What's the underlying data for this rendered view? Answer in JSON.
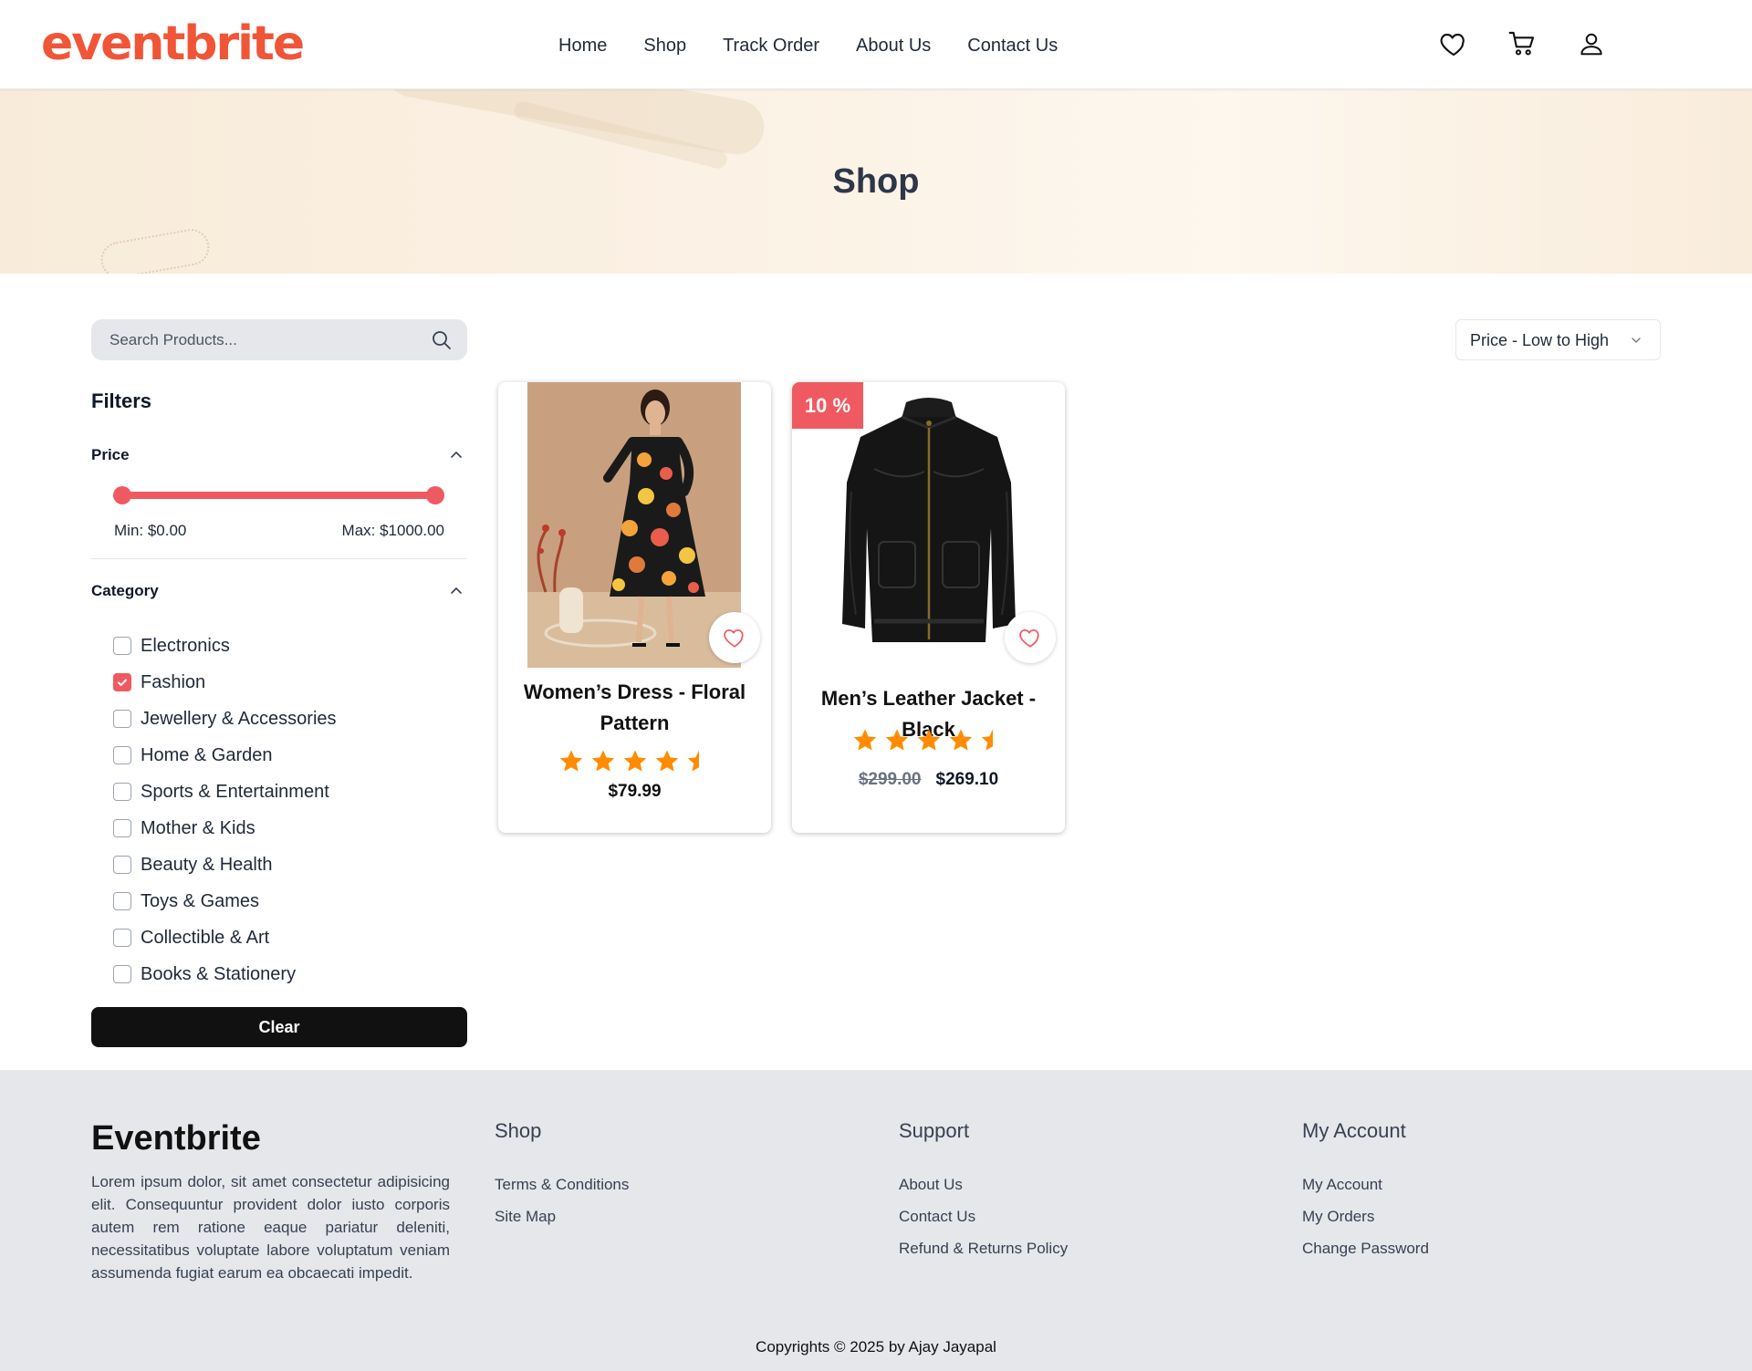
{
  "header": {
    "logo": "eventbrite",
    "nav": [
      "Home",
      "Shop",
      "Track Order",
      "About Us",
      "Contact Us"
    ],
    "icons": [
      "heart-icon",
      "cart-icon",
      "user-icon"
    ]
  },
  "banner": {
    "title": "Shop"
  },
  "sidebar": {
    "search_placeholder": "Search Products...",
    "filters_title": "Filters",
    "price": {
      "title": "Price",
      "min_label": "Min: $0.00",
      "max_label": "Max: $1000.00",
      "min_value": 0,
      "max_value": 1000
    },
    "category": {
      "title": "Category",
      "items": [
        {
          "label": "Electronics",
          "checked": false
        },
        {
          "label": "Fashion",
          "checked": true
        },
        {
          "label": "Jewellery & Accessories",
          "checked": false
        },
        {
          "label": "Home & Garden",
          "checked": false
        },
        {
          "label": "Sports & Entertainment",
          "checked": false
        },
        {
          "label": "Mother & Kids",
          "checked": false
        },
        {
          "label": "Beauty & Health",
          "checked": false
        },
        {
          "label": "Toys & Games",
          "checked": false
        },
        {
          "label": "Collectible & Art",
          "checked": false
        },
        {
          "label": "Books & Stationery",
          "checked": false
        }
      ]
    },
    "clear_label": "Clear"
  },
  "sort": {
    "selected": "Price - Low to High"
  },
  "products": [
    {
      "title": "Women’s Dress - Floral Pattern",
      "rating": 4.5,
      "price": "$79.99"
    },
    {
      "title": "Men’s Leather Jacket - Black",
      "rating": 4.5,
      "badge": "10 %",
      "old_price": "$299.00",
      "price": "$269.10"
    }
  ],
  "footer": {
    "brand": "Eventbrite",
    "description": "Lorem ipsum dolor, sit amet consectetur adipisicing elit. Consequuntur provident dolor iusto corporis autem rem ratione eaque pariatur deleniti, necessitatibus voluptate labore voluptatum veniam assumenda fugiat earum ea obcaecati impedit.",
    "columns": [
      {
        "title": "Shop",
        "links": [
          "Terms & Conditions",
          "Site Map"
        ]
      },
      {
        "title": "Support",
        "links": [
          "About Us",
          "Contact Us",
          "Refund & Returns Policy"
        ]
      },
      {
        "title": "My Account",
        "links": [
          "My Account",
          "My Orders",
          "Change Password"
        ]
      }
    ],
    "copyright": "Copyrights © 2025 by Ajay Jayapal"
  },
  "colors": {
    "brand": "#f05537",
    "accent": "#ef5a61",
    "star": "#ff8c00",
    "footer_bg": "#e5e7eb"
  }
}
